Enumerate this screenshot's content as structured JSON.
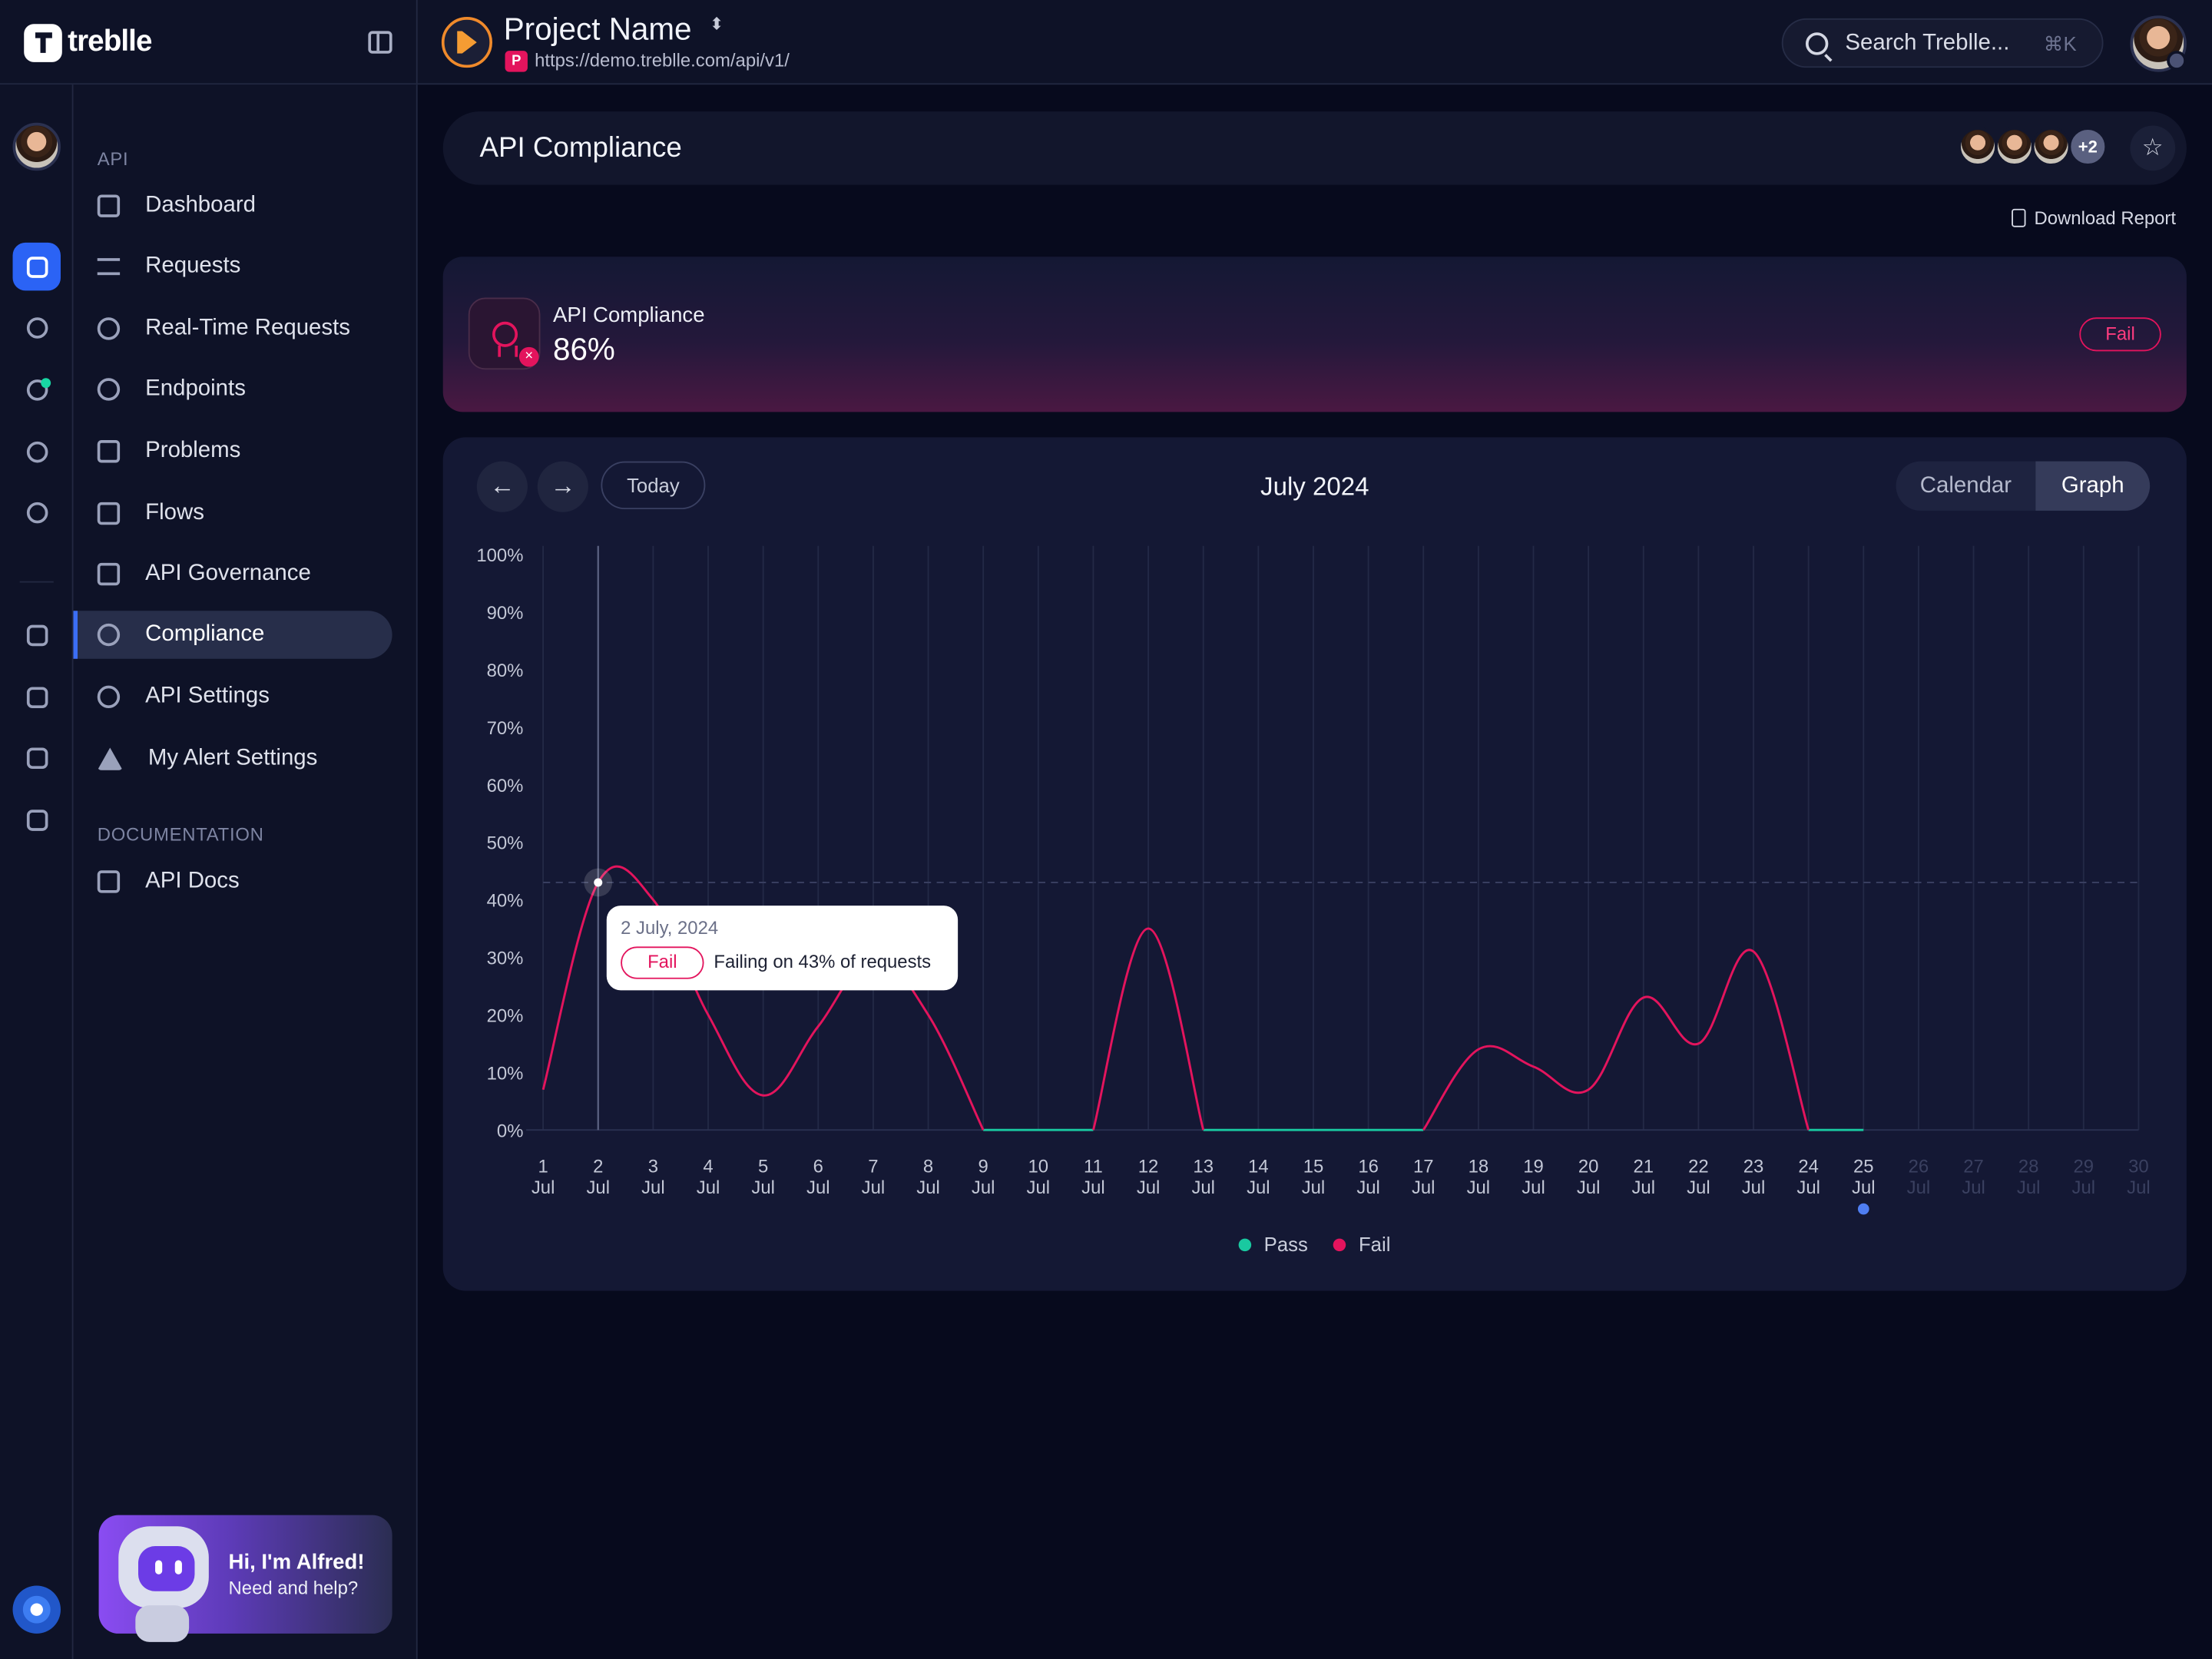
{
  "app": {
    "brand": "treblle"
  },
  "project": {
    "name": "Project Name",
    "caret": "⬍",
    "url_badge": "P",
    "url": "https://demo.treblle.com/api/v1/"
  },
  "search": {
    "placeholder": "Search Treblle...",
    "shortcut": "⌘K"
  },
  "nav": {
    "section_api": "API",
    "section_docs": "DOCUMENTATION",
    "items": [
      {
        "label": "Dashboard",
        "icon": "grid-icon"
      },
      {
        "label": "Requests",
        "icon": "arrows-icon"
      },
      {
        "label": "Real-Time Requests",
        "icon": "stopwatch-icon"
      },
      {
        "label": "Endpoints",
        "icon": "endpoints-icon"
      },
      {
        "label": "Problems",
        "icon": "list-icon"
      },
      {
        "label": "Flows",
        "icon": "flows-icon"
      },
      {
        "label": "API Governance",
        "icon": "governance-icon"
      },
      {
        "label": "Compliance",
        "icon": "award-icon",
        "active": true
      },
      {
        "label": "API Settings",
        "icon": "gear-icon"
      },
      {
        "label": "My Alert Settings",
        "icon": "warning-icon"
      }
    ],
    "docs_items": [
      {
        "label": "API Docs",
        "icon": "code-doc-icon"
      }
    ]
  },
  "alfred": {
    "title": "Hi, I'm Alfred!",
    "subtitle": "Need and help?"
  },
  "page": {
    "title": "API Compliance",
    "collaborators_more": "+2",
    "star": "☆",
    "download": "Download Report"
  },
  "summary": {
    "label": "API Compliance",
    "value": "86%",
    "status": "Fail",
    "status_color": "#e3145d"
  },
  "calendar": {
    "prev": "←",
    "next": "→",
    "today": "Today",
    "month": "July 2024",
    "views": [
      "Calendar",
      "Graph"
    ],
    "active_view": "Graph"
  },
  "tooltip": {
    "date": "2 July, 2024",
    "status": "Fail",
    "text": "Failing on 43% of requests"
  },
  "chart_data": {
    "type": "line",
    "ylim": [
      0,
      100
    ],
    "y_ticks": [
      "0%",
      "10%",
      "20%",
      "30%",
      "40%",
      "50%",
      "60%",
      "70%",
      "80%",
      "90%",
      "100%"
    ],
    "x": [
      1,
      2,
      3,
      4,
      5,
      6,
      7,
      8,
      9,
      10,
      11,
      12,
      13,
      14,
      15,
      16,
      17,
      18,
      19,
      20,
      21,
      22,
      23,
      24,
      25,
      26,
      27,
      28,
      29,
      30
    ],
    "x_month_label": "Jul",
    "today_day": 25,
    "hover_day": 2,
    "hover_value": 43,
    "series": [
      {
        "name": "Pass",
        "color": "#19c9a0",
        "values": [
          null,
          null,
          null,
          null,
          null,
          null,
          null,
          null,
          0,
          0,
          0,
          null,
          0,
          0,
          0,
          0,
          0,
          null,
          null,
          null,
          null,
          null,
          null,
          0,
          0
        ]
      },
      {
        "name": "Fail",
        "color": "#e3145d",
        "values": [
          7,
          43,
          40,
          20,
          6,
          18,
          30,
          20,
          0,
          null,
          0,
          35,
          0,
          null,
          null,
          null,
          0,
          14,
          11,
          7,
          23,
          15,
          31,
          0,
          null
        ]
      }
    ]
  },
  "colors": {
    "accent": "#2b63f5",
    "fail": "#e3145d",
    "pass": "#19c9a0",
    "today_dot": "#4f7ef2"
  }
}
